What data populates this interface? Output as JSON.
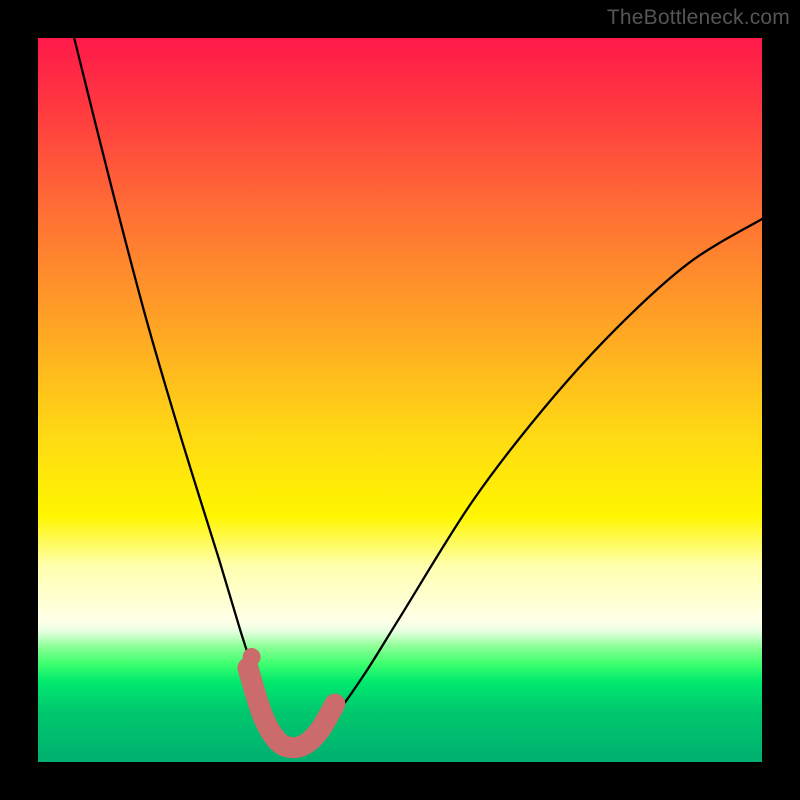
{
  "watermark": "TheBottleneck.com",
  "chart_data": {
    "type": "line",
    "title": "",
    "xlabel": "",
    "ylabel": "",
    "xlim": [
      0,
      100
    ],
    "ylim": [
      0,
      100
    ],
    "grid": false,
    "legend": false,
    "annotations": [],
    "series": [
      {
        "name": "bottleneck-curve",
        "color": "#000000",
        "x": [
          5,
          10,
          15,
          20,
          25,
          28,
          30,
          32,
          34,
          36,
          38,
          40,
          45,
          50,
          60,
          70,
          80,
          90,
          100
        ],
        "y": [
          100,
          80,
          61,
          44,
          28,
          18,
          12,
          7,
          3.5,
          2,
          3,
          5,
          12,
          20,
          36,
          49,
          60,
          69,
          75
        ]
      },
      {
        "name": "highlight-band",
        "color": "#cc6b6b",
        "x": [
          29,
          31,
          33,
          35,
          37,
          39,
          41
        ],
        "y": [
          13,
          6.5,
          3,
          2,
          2.5,
          4.5,
          8
        ]
      },
      {
        "name": "highlight-dot",
        "color": "#cc6b6b",
        "x": [
          29.5
        ],
        "y": [
          14.5
        ]
      }
    ]
  }
}
